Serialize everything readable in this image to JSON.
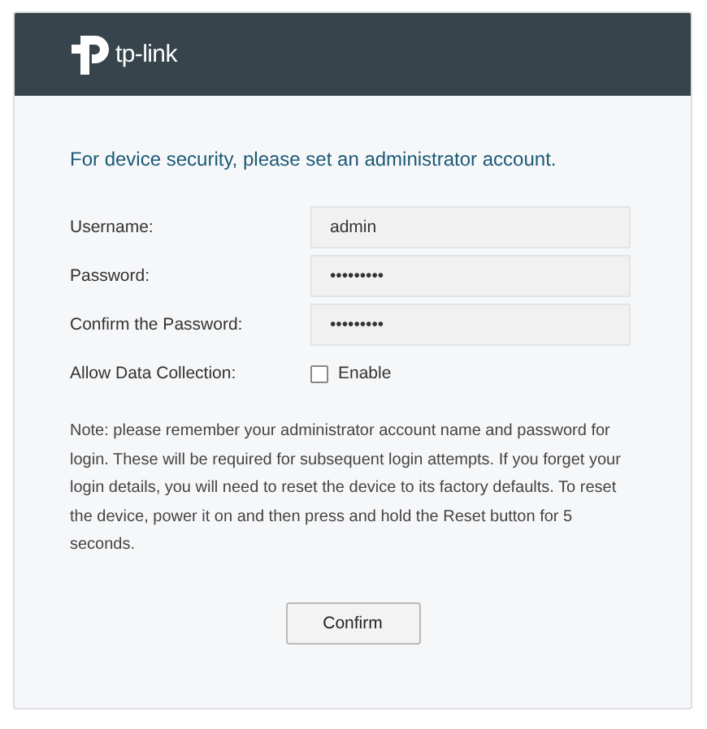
{
  "header": {
    "brand": "tp-link"
  },
  "heading": "For device security, please set an administrator account.",
  "fields": [
    {
      "kind": "text",
      "label": "Username:",
      "value": "admin"
    },
    {
      "kind": "text",
      "label": "Password:",
      "value": "•••••••••"
    },
    {
      "kind": "text",
      "label": "Confirm the Password:",
      "value": "•••••••••"
    },
    {
      "kind": "checkbox",
      "label": "Allow Data Collection:",
      "option": "Enable",
      "checked": false
    }
  ],
  "note": "Note: please remember your administrator account name and password for login. These will be required for subsequent login attempts. If you forget your login details, you will need to reset the device to its factory defaults. To reset the device, power it on and then press and hold the Reset button for 5 seconds.",
  "buttons": [
    "Confirm"
  ]
}
